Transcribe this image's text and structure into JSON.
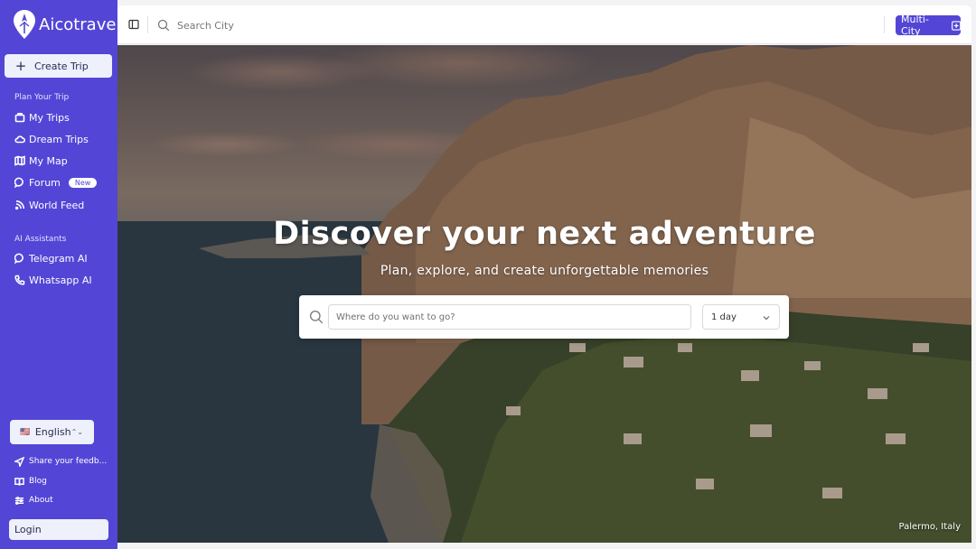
{
  "brand": {
    "name": "Aicotrave",
    "icon": "compass-pin-icon"
  },
  "sidebar": {
    "create_label": "Create Trip",
    "sections": {
      "plan": "Plan Your Trip",
      "ai": "AI Assistants"
    },
    "items": [
      {
        "label": "My Trips",
        "icon": "luggage-icon"
      },
      {
        "label": "Dream Trips",
        "icon": "cloud-icon"
      },
      {
        "label": "My Map",
        "icon": "map-icon"
      },
      {
        "label": "Forum",
        "icon": "chat-bubble-icon",
        "badge": "New"
      },
      {
        "label": "World Feed",
        "icon": "rss-icon"
      }
    ],
    "ai_items": [
      {
        "label": "Telegram AI",
        "icon": "chat-bubble-icon"
      },
      {
        "label": "Whatsapp AI",
        "icon": "phone-icon"
      }
    ],
    "language": {
      "flag": "🇺🇸",
      "value": "English"
    },
    "footer": [
      {
        "label": "Share your feedb...",
        "icon": "send-icon"
      },
      {
        "label": "Blog",
        "icon": "book-icon"
      },
      {
        "label": "About",
        "icon": "sliders-icon"
      }
    ],
    "login_label": "Login"
  },
  "topbar": {
    "search_placeholder": "Search City",
    "multi_city_label": "Multi-City"
  },
  "hero": {
    "title": "Discover your next adventure",
    "subtitle": "Plan, explore, and create unforgettable memories",
    "destination_placeholder": "Where do you want to go?",
    "duration_value": "1 day",
    "photo_caption": "Palermo, Italy"
  },
  "colors": {
    "sidebar_bg": "#5346d6",
    "accent": "#5346d6",
    "button_light": "#eef0fb"
  }
}
